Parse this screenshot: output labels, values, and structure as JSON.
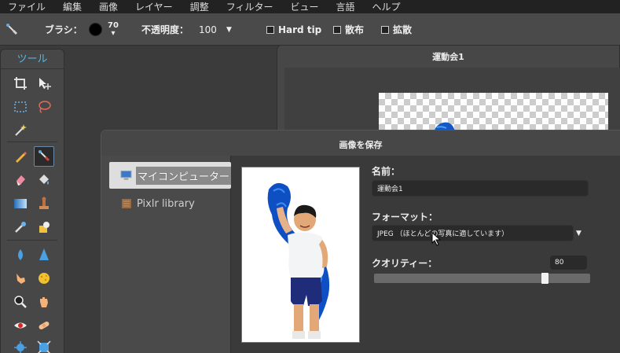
{
  "menu": [
    "ファイル",
    "編集",
    "画像",
    "レイヤー",
    "調整",
    "フィルター",
    "ビュー",
    "言語",
    "ヘルプ"
  ],
  "toolbar": {
    "brush_label": "ブラシ：",
    "brush_size": "70",
    "opacity_label": "不透明度：",
    "opacity_value": "100",
    "hard_tip_label": "Hard tip",
    "scatter_label": "散布",
    "spread_label": "拡散"
  },
  "tools_panel": {
    "title": "ツール"
  },
  "document": {
    "title": "運動会1"
  },
  "save_dialog": {
    "title": "画像を保存",
    "locations": [
      {
        "label": "マイコンピューター",
        "icon": "monitor-icon",
        "selected": true
      },
      {
        "label": "Pixlr library",
        "icon": "book-icon",
        "selected": false
      }
    ],
    "name_label": "名前：",
    "name_value": "運動会1",
    "format_label": "フォーマット：",
    "format_value": "JPEG （ほとんどの写真に適しています）",
    "quality_label": "クオリティー：",
    "quality_value": "80",
    "quality_fraction": 0.8
  },
  "colors": {
    "accent_blue": "#53b5e8",
    "menubar_bg": "#222222",
    "panel_bg": "#474747"
  }
}
